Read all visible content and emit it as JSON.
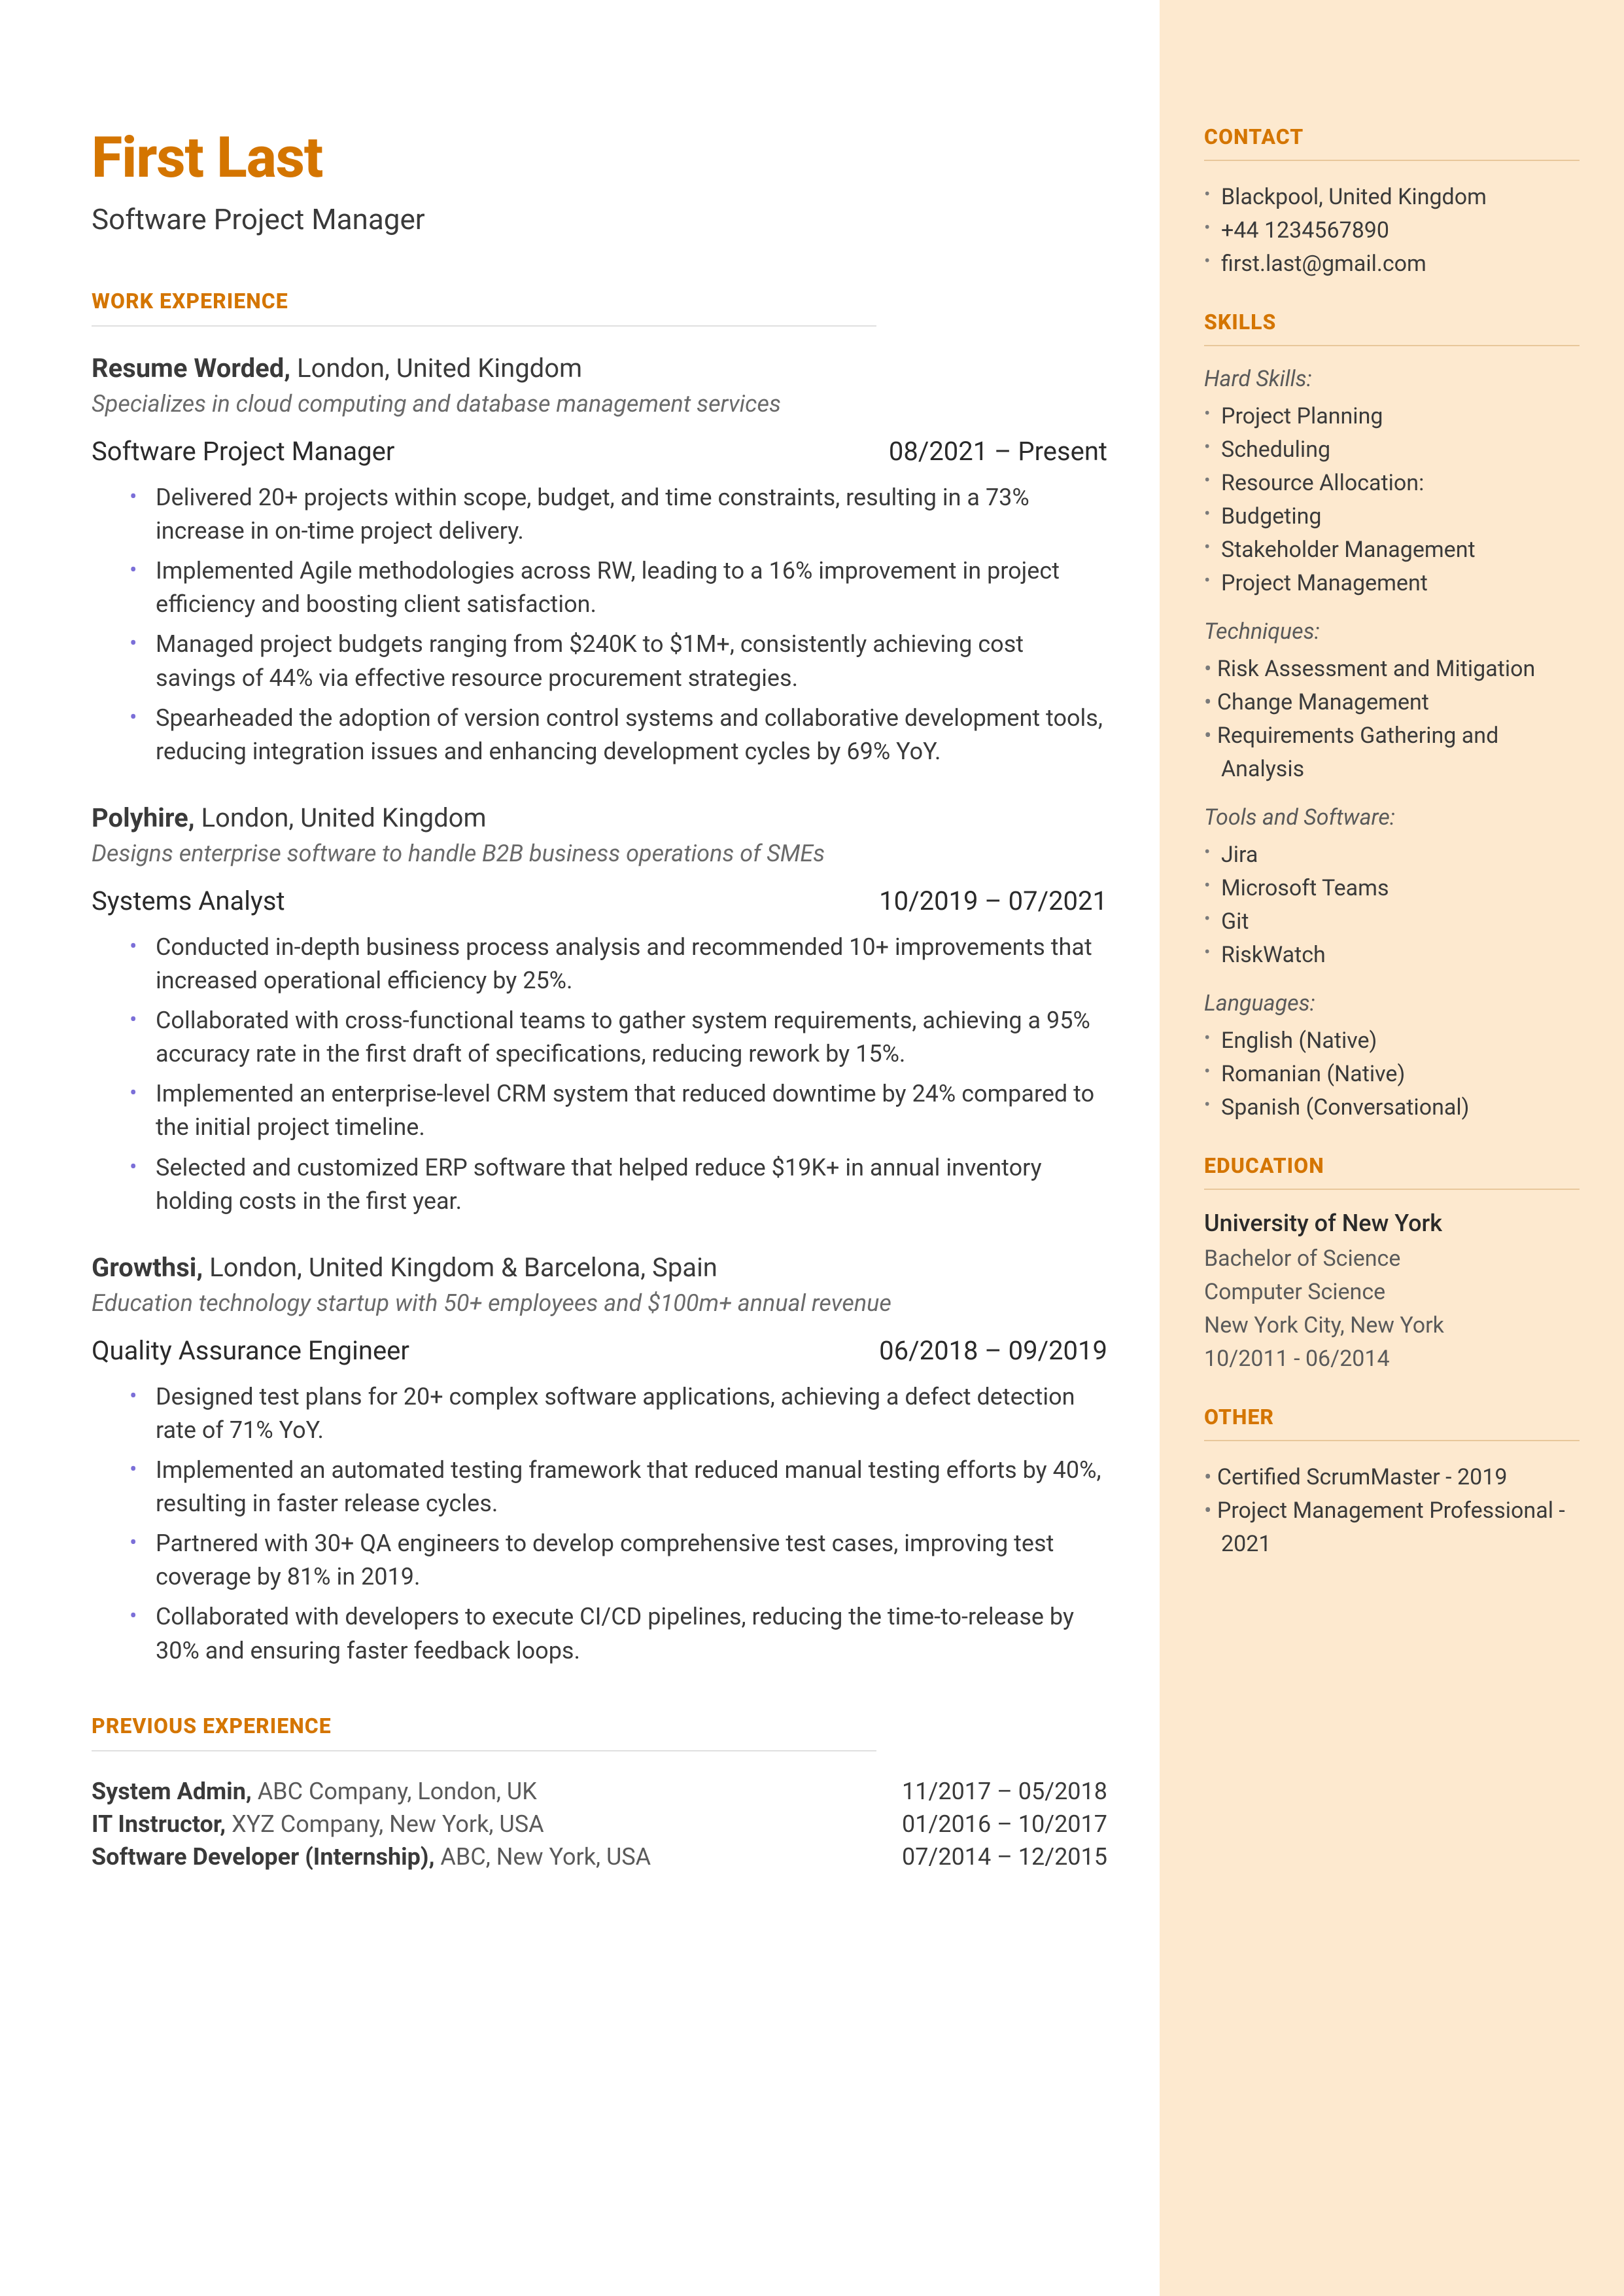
{
  "header": {
    "name": "First Last",
    "title": "Software Project Manager"
  },
  "sections": {
    "work_experience": "WORK EXPERIENCE",
    "previous_experience": "PREVIOUS EXPERIENCE",
    "contact": "CONTACT",
    "skills": "SKILLS",
    "education": "EDUCATION",
    "other": "OTHER"
  },
  "work": [
    {
      "company": "Resume Worded,",
      "location": "London, United Kingdom",
      "desc": "Specializes in cloud computing and database management services",
      "role": "Software Project Manager",
      "dates": "08/2021 – Present",
      "bullets": [
        "Delivered 20+ projects within scope, budget, and time constraints, resulting in a 73% increase in on-time project delivery.",
        "Implemented Agile methodologies across RW, leading to a 16% improvement in project efficiency and boosting client satisfaction.",
        "Managed project budgets ranging from $240K to $1M+, consistently achieving cost savings of 44% via effective resource procurement strategies.",
        "Spearheaded the adoption of version control systems and collaborative development tools, reducing integration issues and enhancing development cycles by 69% YoY."
      ]
    },
    {
      "company": "Polyhire,",
      "location": "London, United Kingdom",
      "desc": "Designs enterprise software to handle B2B business operations of SMEs",
      "role": "Systems Analyst",
      "dates": "10/2019 – 07/2021",
      "bullets": [
        "Conducted in-depth business process analysis and recommended 10+ improvements that increased operational efficiency by 25%.",
        "Collaborated with cross-functional teams to gather system requirements, achieving a 95% accuracy rate in the first draft of specifications, reducing rework by 15%.",
        "Implemented an enterprise-level CRM system that reduced downtime by 24% compared to the initial project timeline.",
        "Selected and customized ERP software that helped reduce $19K+ in annual inventory holding costs in the first year."
      ]
    },
    {
      "company": "Growthsi,",
      "location": "London, United Kingdom & Barcelona, Spain",
      "desc": "Education technology startup with 50+ employees and $100m+ annual revenue",
      "role": "Quality Assurance Engineer",
      "dates": "06/2018 – 09/2019",
      "bullets": [
        "Designed test plans for 20+ complex software applications, achieving a defect detection rate of 71% YoY.",
        "Implemented an automated testing framework that reduced manual testing efforts by 40%, resulting in faster release cycles.",
        "Partnered with 30+ QA engineers to develop comprehensive test cases, improving test coverage by 81% in 2019.",
        "Collaborated with developers to execute CI/CD pipelines, reducing the time-to-release by 30% and ensuring faster feedback loops."
      ]
    }
  ],
  "previous": [
    {
      "title": "System Admin,",
      "loc": "ABC Company, London, UK",
      "dates": "11/2017 – 05/2018"
    },
    {
      "title": "IT Instructor,",
      "loc": "XYZ Company, New York, USA",
      "dates": "01/2016 – 10/2017"
    },
    {
      "title": "Software Developer (Internship),",
      "loc": "ABC, New York, USA",
      "dates": "07/2014 – 12/2015"
    }
  ],
  "contact": [
    "Blackpool, United Kingdom",
    "+44 1234567890",
    "first.last@gmail.com"
  ],
  "skills": {
    "hard_label": "Hard Skills:",
    "hard": [
      "Project Planning",
      "Scheduling",
      "Resource Allocation:",
      "Budgeting",
      "Stakeholder Management",
      "Project Management"
    ],
    "techniques_label": "Techniques:",
    "techniques": [
      "Risk Assessment and Mitigation",
      "Change Management",
      "Requirements Gathering and Analysis"
    ],
    "tools_label": "Tools and Software:",
    "tools": [
      "Jira",
      "Microsoft Teams",
      "Git",
      "RiskWatch"
    ],
    "languages_label": "Languages:",
    "languages": [
      "English (Native)",
      "Romanian (Native)",
      "Spanish (Conversational)"
    ]
  },
  "education": {
    "school": "University of New York",
    "degree": "Bachelor of Science",
    "major": "Computer Science",
    "loc": "New York City, New York",
    "dates": "10/2011 - 06/2014"
  },
  "other": [
    "Certified ScrumMaster - 2019",
    "Project Management Professional - 2021"
  ]
}
